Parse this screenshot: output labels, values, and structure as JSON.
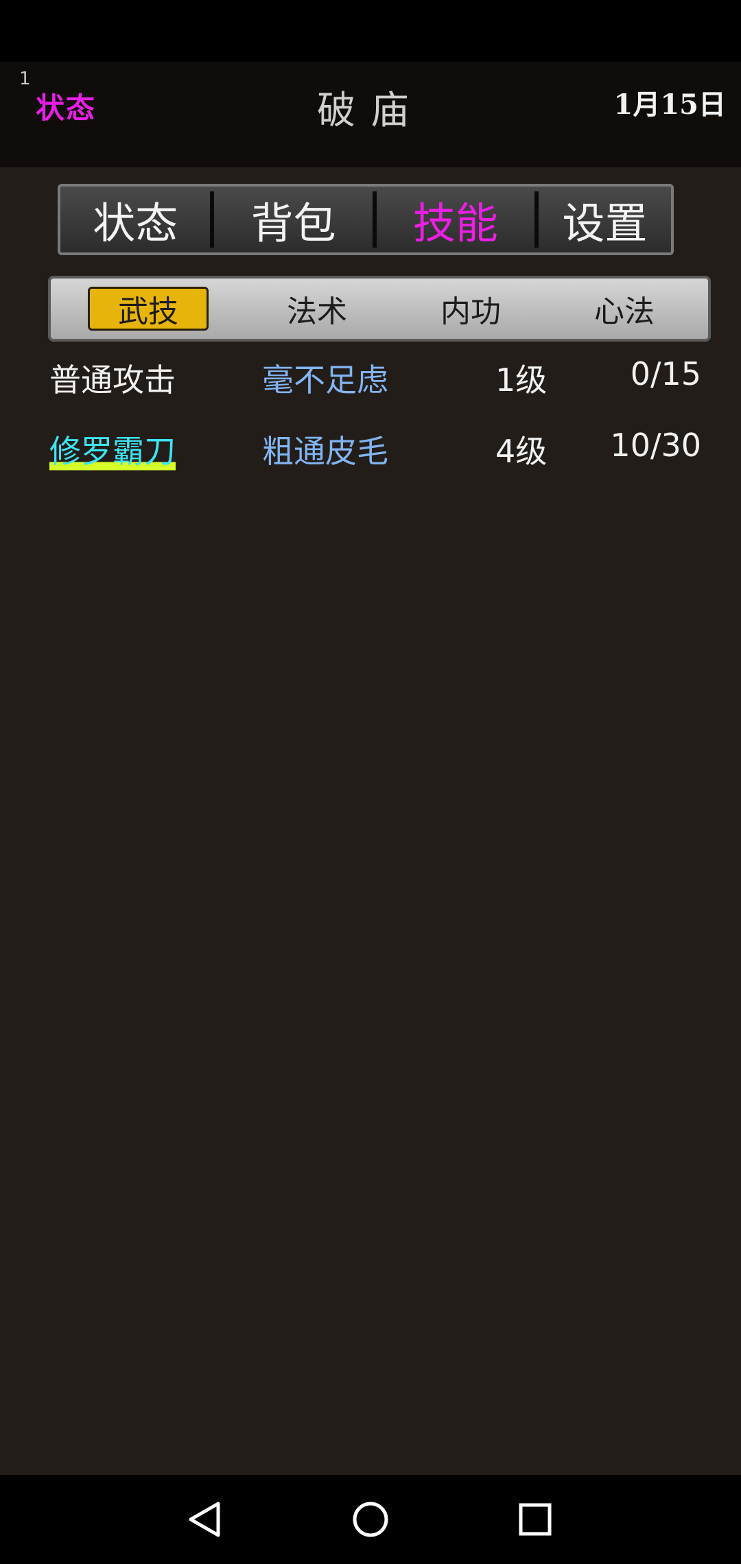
{
  "header": {
    "count": "1",
    "state_label": "状态",
    "location": "破庙",
    "date": "1月15日"
  },
  "main_tabs": [
    {
      "label": "状态",
      "active": false
    },
    {
      "label": "背包",
      "active": false
    },
    {
      "label": "技能",
      "active": true
    },
    {
      "label": "设置",
      "active": false
    }
  ],
  "sub_tabs": [
    {
      "label": "武技",
      "active": true
    },
    {
      "label": "法术",
      "active": false
    },
    {
      "label": "内功",
      "active": false
    },
    {
      "label": "心法",
      "active": false
    }
  ],
  "skills": [
    {
      "name": "普通攻击",
      "rank": "毫不足虑",
      "level": "1级",
      "progress": "0/15",
      "highlight": false
    },
    {
      "name": "修罗霸刀",
      "rank": "粗通皮毛",
      "level": "4级",
      "progress": "10/30",
      "highlight": true
    }
  ],
  "navbar": {
    "icons": [
      "back-icon",
      "home-icon",
      "recent-apps-icon"
    ]
  },
  "colors": {
    "accent_magenta": "#ee1ee6",
    "active_subtab": "#e7b40c",
    "rank_blue": "#82b4f2",
    "highlight_cyan": "#3ce4f2",
    "background": "#231d19"
  }
}
